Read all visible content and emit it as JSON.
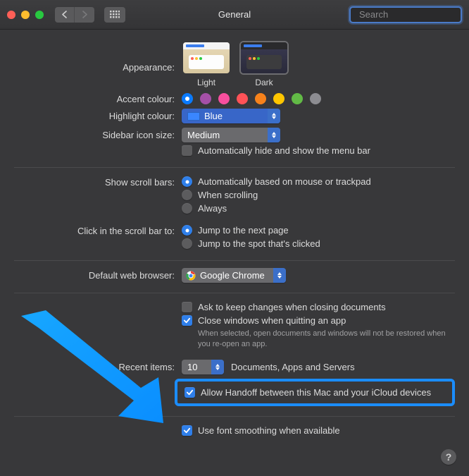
{
  "window": {
    "title": "General"
  },
  "search": {
    "placeholder": "Search",
    "value": ""
  },
  "labels": {
    "appearance": "Appearance:",
    "accent": "Accent colour:",
    "highlight": "Highlight colour:",
    "sidebar_size": "Sidebar icon size:",
    "scroll_bars": "Show scroll bars:",
    "click_scroll": "Click in the scroll bar to:",
    "browser": "Default web browser:",
    "recent": "Recent items:"
  },
  "appearance": {
    "light": "Light",
    "dark": "Dark",
    "selected": "dark"
  },
  "accent_colors": [
    {
      "name": "blue",
      "hex": "#0a7bff",
      "selected": true
    },
    {
      "name": "purple",
      "hex": "#a550a7",
      "selected": false
    },
    {
      "name": "pink",
      "hex": "#f74f9e",
      "selected": false
    },
    {
      "name": "red",
      "hex": "#ff5257",
      "selected": false
    },
    {
      "name": "orange",
      "hex": "#f7821b",
      "selected": false
    },
    {
      "name": "yellow",
      "hex": "#ffc600",
      "selected": false
    },
    {
      "name": "green",
      "hex": "#62ba46",
      "selected": false
    },
    {
      "name": "graphite",
      "hex": "#8c8c91",
      "selected": false
    }
  ],
  "highlight_colour": "Blue",
  "sidebar_size": "Medium",
  "menubar_autohide": {
    "label": "Automatically hide and show the menu bar",
    "checked": false
  },
  "scroll": {
    "auto": "Automatically based on mouse or trackpad",
    "scrolling": "When scrolling",
    "always": "Always",
    "selected": "auto"
  },
  "click_scroll": {
    "next": "Jump to the next page",
    "spot": "Jump to the spot that's clicked",
    "selected": "next"
  },
  "browser": "Google Chrome",
  "documents": {
    "ask_keep": {
      "label": "Ask to keep changes when closing documents",
      "checked": false
    },
    "close_windows": {
      "label": "Close windows when quitting an app",
      "checked": true
    },
    "close_windows_hint": "When selected, open documents and windows will not be restored when you re-open an app."
  },
  "recent": {
    "value": "10",
    "suffix": "Documents, Apps and Servers"
  },
  "handoff": {
    "label": "Allow Handoff between this Mac and your iCloud devices",
    "checked": true
  },
  "font_smoothing": {
    "label": "Use font smoothing when available",
    "checked": true
  },
  "help_glyph": "?"
}
